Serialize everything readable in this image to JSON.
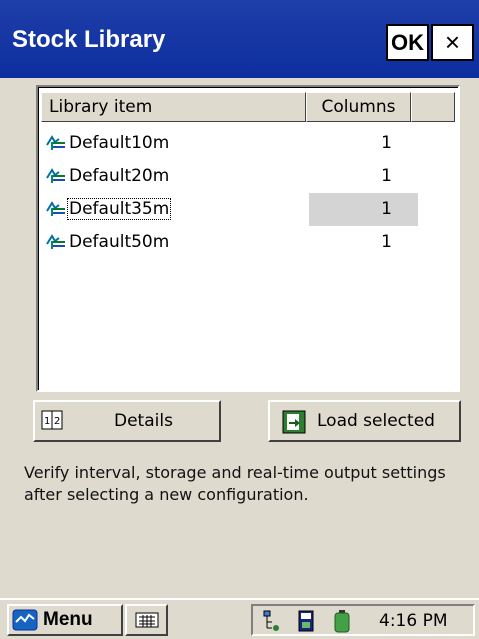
{
  "window": {
    "title": "Stock Library",
    "ok_label": "OK",
    "close_label": "×"
  },
  "list": {
    "headers": {
      "item": "Library item",
      "columns": "Columns"
    },
    "rows": [
      {
        "name": "Default10m",
        "columns": "1",
        "selected": false,
        "icon": "stock-item-icon"
      },
      {
        "name": "Default20m",
        "columns": "1",
        "selected": false,
        "icon": "stock-item-icon"
      },
      {
        "name": "Default35m",
        "columns": "1",
        "selected": true,
        "icon": "stock-item-icon"
      },
      {
        "name": "Default50m",
        "columns": "1",
        "selected": false,
        "icon": "stock-item-icon"
      }
    ]
  },
  "buttons": {
    "details_label": "Details",
    "details_icon": "details-icon",
    "load_label": "Load selected",
    "load_icon": "load-icon"
  },
  "hint": "Verify interval, storage and real-time output settings after selecting a new configuration.",
  "taskbar": {
    "start_label": "Menu",
    "start_icon": "start-logo-icon",
    "keyboard_icon": "keyboard-icon",
    "tray_icons": [
      "network-icon",
      "storage-card-icon",
      "battery-icon"
    ],
    "clock": "4:16 PM"
  },
  "colors": {
    "titlebar": "#1e3ea8",
    "face": "#dedbce",
    "selection": "#d4d4d4"
  }
}
